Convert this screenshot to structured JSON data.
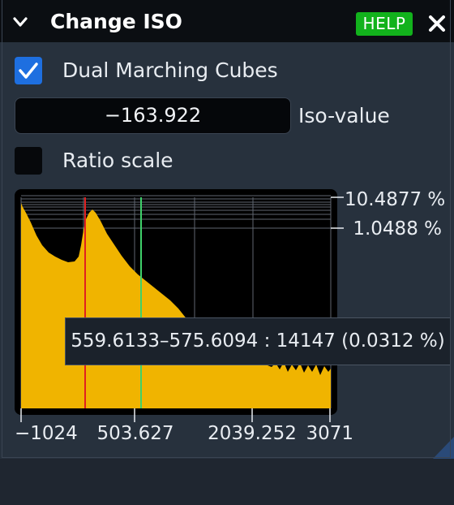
{
  "header": {
    "title": "Change ISO",
    "help_label": "HELP",
    "icons": {
      "collapse": "chevron-down-icon",
      "close": "close-icon"
    }
  },
  "dual_marching_cubes": {
    "label": "Dual Marching Cubes",
    "checked": true
  },
  "iso_value": {
    "value": "−163.922",
    "label": "Iso-value"
  },
  "ratio_scale": {
    "label": "Ratio scale",
    "checked": false
  },
  "histogram": {
    "right_labels": [
      "10.4877 %",
      "1.0488 %"
    ],
    "x_ticks": [
      "−1024",
      "503.627",
      "2039.252",
      "3071"
    ],
    "tooltip": "559.6133–575.6094 : 14147 (0.0312 %)",
    "colors": {
      "fill": "#f0b400",
      "iso_line": "#e02020",
      "cursor_line": "#3fd06a",
      "grid": "#5f6670"
    }
  },
  "colors": {
    "accent": "#1e6fe0",
    "help": "#12b21c",
    "panel": "#27313d",
    "header": "#0b0e12"
  }
}
